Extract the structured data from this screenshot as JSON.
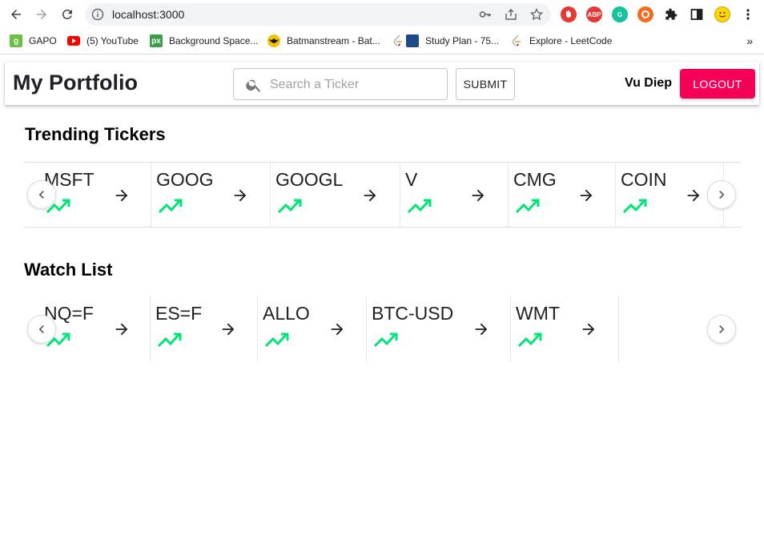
{
  "browser": {
    "url": "localhost:3000",
    "bookmarks": [
      {
        "label": "GAPO",
        "icon": "gapo-icon",
        "color": "#6ac046"
      },
      {
        "label": "(5) YouTube",
        "icon": "youtube-icon",
        "color": "#ff0000"
      },
      {
        "label": "Background Space...",
        "icon": "px-icon",
        "color": "#3b9e4d"
      },
      {
        "label": "Batmanstream - Bat...",
        "icon": "batman-icon",
        "color": "#222222"
      },
      {
        "label": "Study Plan - 75...",
        "icon": "leetcode-icon",
        "color": "#f89f1b"
      },
      {
        "label": "Explore - LeetCode",
        "icon": "leetcode-icon",
        "color": "#f89f1b"
      }
    ],
    "bookmarks_more": "»"
  },
  "header": {
    "title": "My Portfolio",
    "search_placeholder": "Search a Ticker",
    "submit_label": "SUBMIT",
    "username": "Vu Diep",
    "logout_label": "LOGOUT"
  },
  "trending": {
    "title": "Trending Tickers",
    "tickers": [
      "MSFT",
      "GOOG",
      "GOOGL",
      "V",
      "CMG",
      "COIN"
    ]
  },
  "watchlist": {
    "title": "Watch List",
    "tickers": [
      "NQ=F",
      "ES=F",
      "ALLO",
      "BTC-USD",
      "WMT"
    ]
  },
  "colors": {
    "accent": "#f50057",
    "trend_up": "#00e676"
  }
}
